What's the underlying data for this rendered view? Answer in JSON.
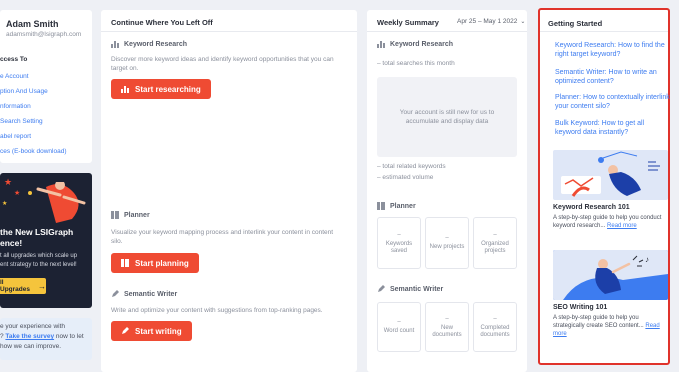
{
  "profile": {
    "name": "Adam Smith",
    "email": "adamsmith@lsigraph.com",
    "access_title": "ccess To",
    "links": [
      "e Account",
      "ption And Usage",
      "nformation",
      "Search Setting",
      "abel report",
      "ces (E-book download)"
    ]
  },
  "promo": {
    "title_line1": "the New LSIGraph",
    "title_line2": "ence!",
    "text_line1": "t all upgrades which scale up",
    "text_line2": "ent strategy to the next level!",
    "button": "ll Upgrades"
  },
  "survey": {
    "prefix": "e your experience with",
    "link_prefix": "? ",
    "link": "Take the survey",
    "suffix": " now to let",
    "line3": "how we can improve."
  },
  "continue": {
    "title": "Continue Where You Left Off",
    "keyword": {
      "title": "Keyword Research",
      "desc": "Discover more keyword ideas and identify keyword opportunities that you can target on.",
      "button": "Start researching"
    },
    "planner": {
      "title": "Planner",
      "desc": "Visualize your keyword mapping process and interlink your content in content silo.",
      "button": "Start planning"
    },
    "semantic": {
      "title": "Semantic Writer",
      "desc": "Write and optimize your content with suggestions from top-ranking pages.",
      "button": "Start writing"
    }
  },
  "weekly": {
    "title": "Weekly Summary",
    "range": "Apr 25 – May 1 2022",
    "keyword_title": "Keyword Research",
    "total_searches": "– total searches this month",
    "empty_msg": "Your account is still new for us to accumulate and display data",
    "total_related": "– total related keywords",
    "estimated_volume": "– estimated volume",
    "planner_title": "Planner",
    "planner_stats": [
      {
        "value": "–",
        "label": "Keywords saved"
      },
      {
        "value": "–",
        "label": "New projects"
      },
      {
        "value": "–",
        "label": "Organized projects"
      }
    ],
    "semantic_title": "Semantic Writer",
    "semantic_stats": [
      {
        "value": "–",
        "label": "Word count"
      },
      {
        "value": "–",
        "label": "New documents"
      },
      {
        "value": "–",
        "label": "Completed documents"
      }
    ]
  },
  "getting_started": {
    "title": "Getting Started",
    "links": [
      "Keyword Research: How to find the right target keyword?",
      "Semantic Writer: How to write an optimized content?",
      "Planner:  How to contextually interlink your content silo?",
      "Bulk Keyword: How to get all keyword data instantly?"
    ],
    "articles": [
      {
        "title": "Keyword Research 101",
        "text": "A step-by-step guide to help you conduct keyword research... ",
        "more": "Read more"
      },
      {
        "title": "SEO Writing 101",
        "text": "A step-by-step guide to help you strategically create SEO content... ",
        "more": "Read more"
      }
    ]
  },
  "colors": {
    "accent": "#ef4b33",
    "link": "#3d7cf0",
    "highlight_border": "#e0332b"
  }
}
